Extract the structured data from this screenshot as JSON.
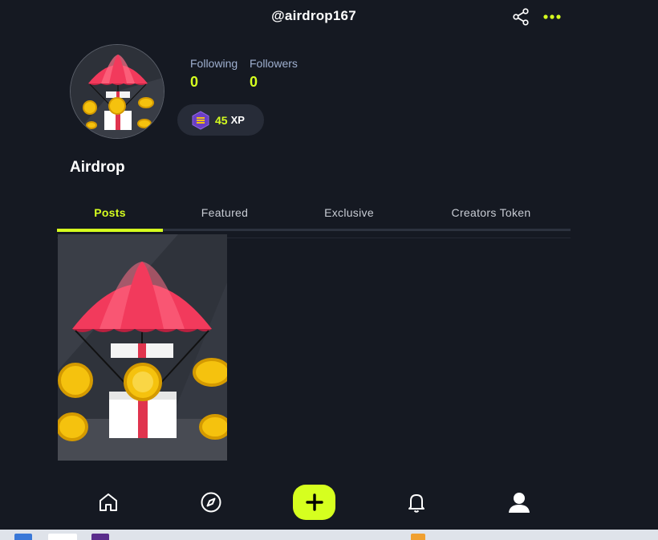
{
  "header": {
    "username": "@airdrop167"
  },
  "profile": {
    "avatar_alt": "Airdrop",
    "display_name": "Airdrop",
    "stats": [
      {
        "label": "Following",
        "value": "0"
      },
      {
        "label": "Followers",
        "value": "0"
      }
    ],
    "xp": {
      "value": "45",
      "unit": "XP"
    }
  },
  "tabs": [
    {
      "label": "Posts",
      "active": true
    },
    {
      "label": "Featured",
      "active": false
    },
    {
      "label": "Exclusive",
      "active": false
    },
    {
      "label": "Creators Token",
      "active": false
    }
  ],
  "bottom_nav": [
    {
      "icon": "home-icon"
    },
    {
      "icon": "compass-icon"
    },
    {
      "icon": "plus-icon"
    },
    {
      "icon": "bell-icon"
    },
    {
      "icon": "user-icon"
    }
  ],
  "colors": {
    "background": "#151922",
    "accent": "#d6ff1f",
    "label": "#9fb0d0",
    "pill": "#272c38"
  }
}
